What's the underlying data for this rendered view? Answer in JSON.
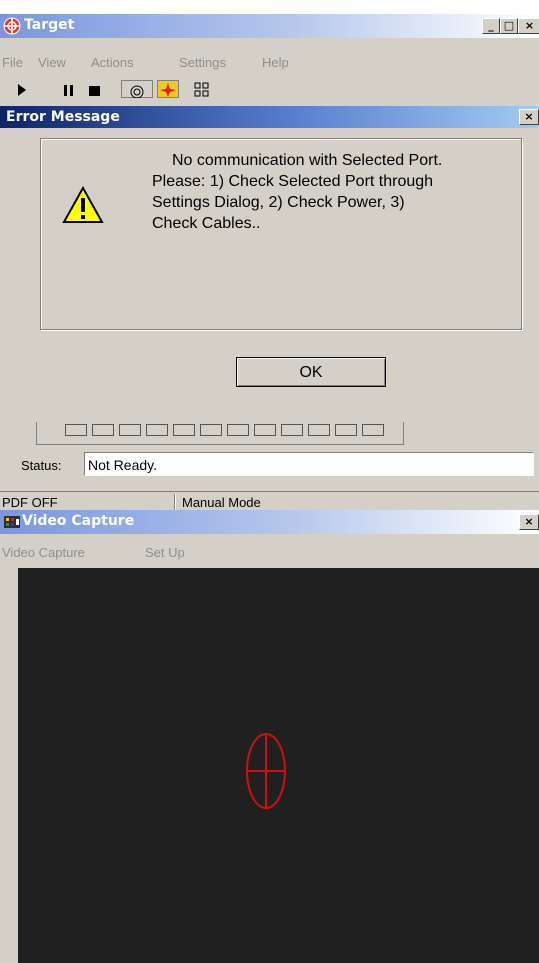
{
  "target_window": {
    "title": "Target",
    "menu": [
      "File",
      "View",
      "Actions",
      "Settings",
      "Help"
    ],
    "status_label": "Status:",
    "status_value": "Not Ready.",
    "statusbar": [
      "PDF OFF",
      "Manual Mode"
    ]
  },
  "error_dialog": {
    "title": "Error Message",
    "message_lines": [
      "No communication with Selected Port.",
      "Please: 1) Check Selected Port through",
      "Settings Dialog, 2) Check Power, 3)",
      "Check Cables.."
    ],
    "ok_label": "OK",
    "close_label": "×"
  },
  "video_window": {
    "title": "Video Capture",
    "menu": [
      "Video Capture",
      "Set Up"
    ]
  },
  "colors": {
    "crosshair": "#d01010",
    "video_bg": "#202020",
    "dialog_bg": "#d4d0c8"
  }
}
